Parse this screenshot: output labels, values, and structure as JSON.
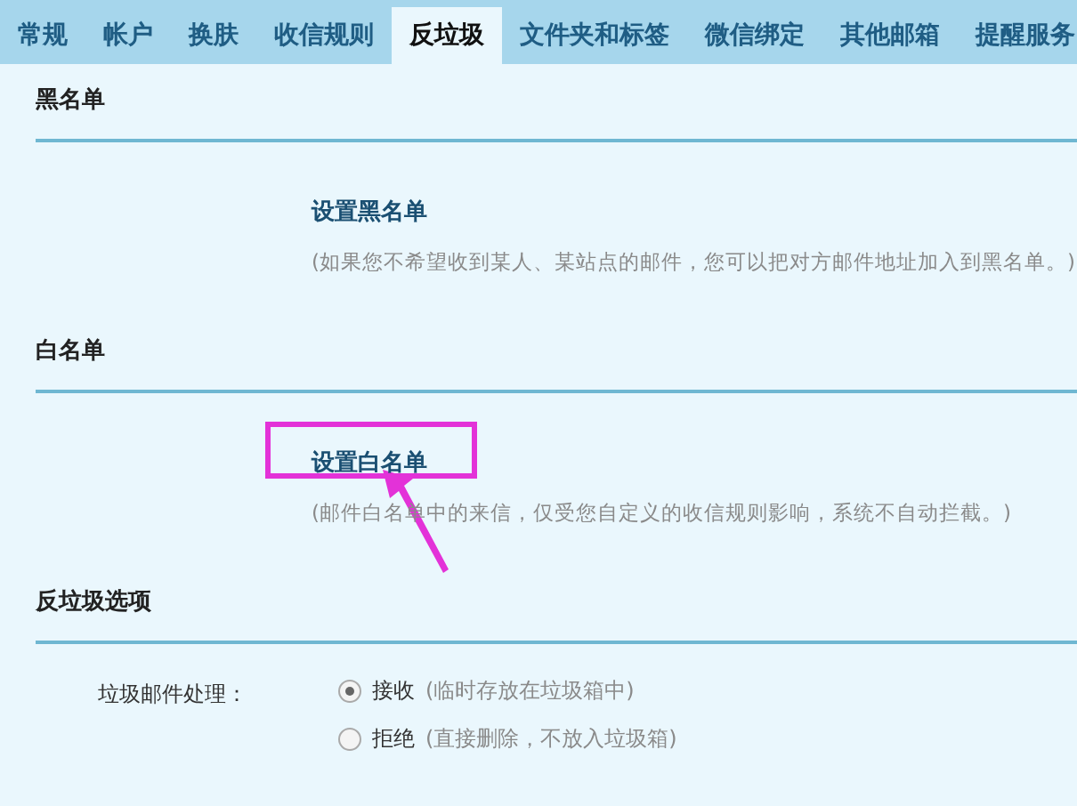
{
  "tabs": [
    {
      "label": "常规",
      "selected": false
    },
    {
      "label": "帐户",
      "selected": false
    },
    {
      "label": "换肤",
      "selected": false
    },
    {
      "label": "收信规则",
      "selected": false
    },
    {
      "label": "反垃圾",
      "selected": true
    },
    {
      "label": "文件夹和标签",
      "selected": false
    },
    {
      "label": "微信绑定",
      "selected": false
    },
    {
      "label": "其他邮箱",
      "selected": false
    },
    {
      "label": "提醒服务",
      "selected": false
    }
  ],
  "sections": [
    {
      "title": "黑名单",
      "link": "设置黑名单",
      "description": "(如果您不希望收到某人、某站点的邮件，您可以把对方邮件地址加入到黑名单。)",
      "highlighted": false
    },
    {
      "title": "白名单",
      "link": "设置白名单",
      "description": "(邮件白名单中的来信，仅受您自定义的收信规则影响，系统不自动拦截。)",
      "highlighted": true
    }
  ],
  "options": {
    "title": "反垃圾选项",
    "label": "垃圾邮件处理：",
    "choices": [
      {
        "label": "接收",
        "note": "(临时存放在垃圾箱中)",
        "selected": true
      },
      {
        "label": "拒绝",
        "note": "(直接删除，不放入垃圾箱)",
        "selected": false
      }
    ]
  }
}
